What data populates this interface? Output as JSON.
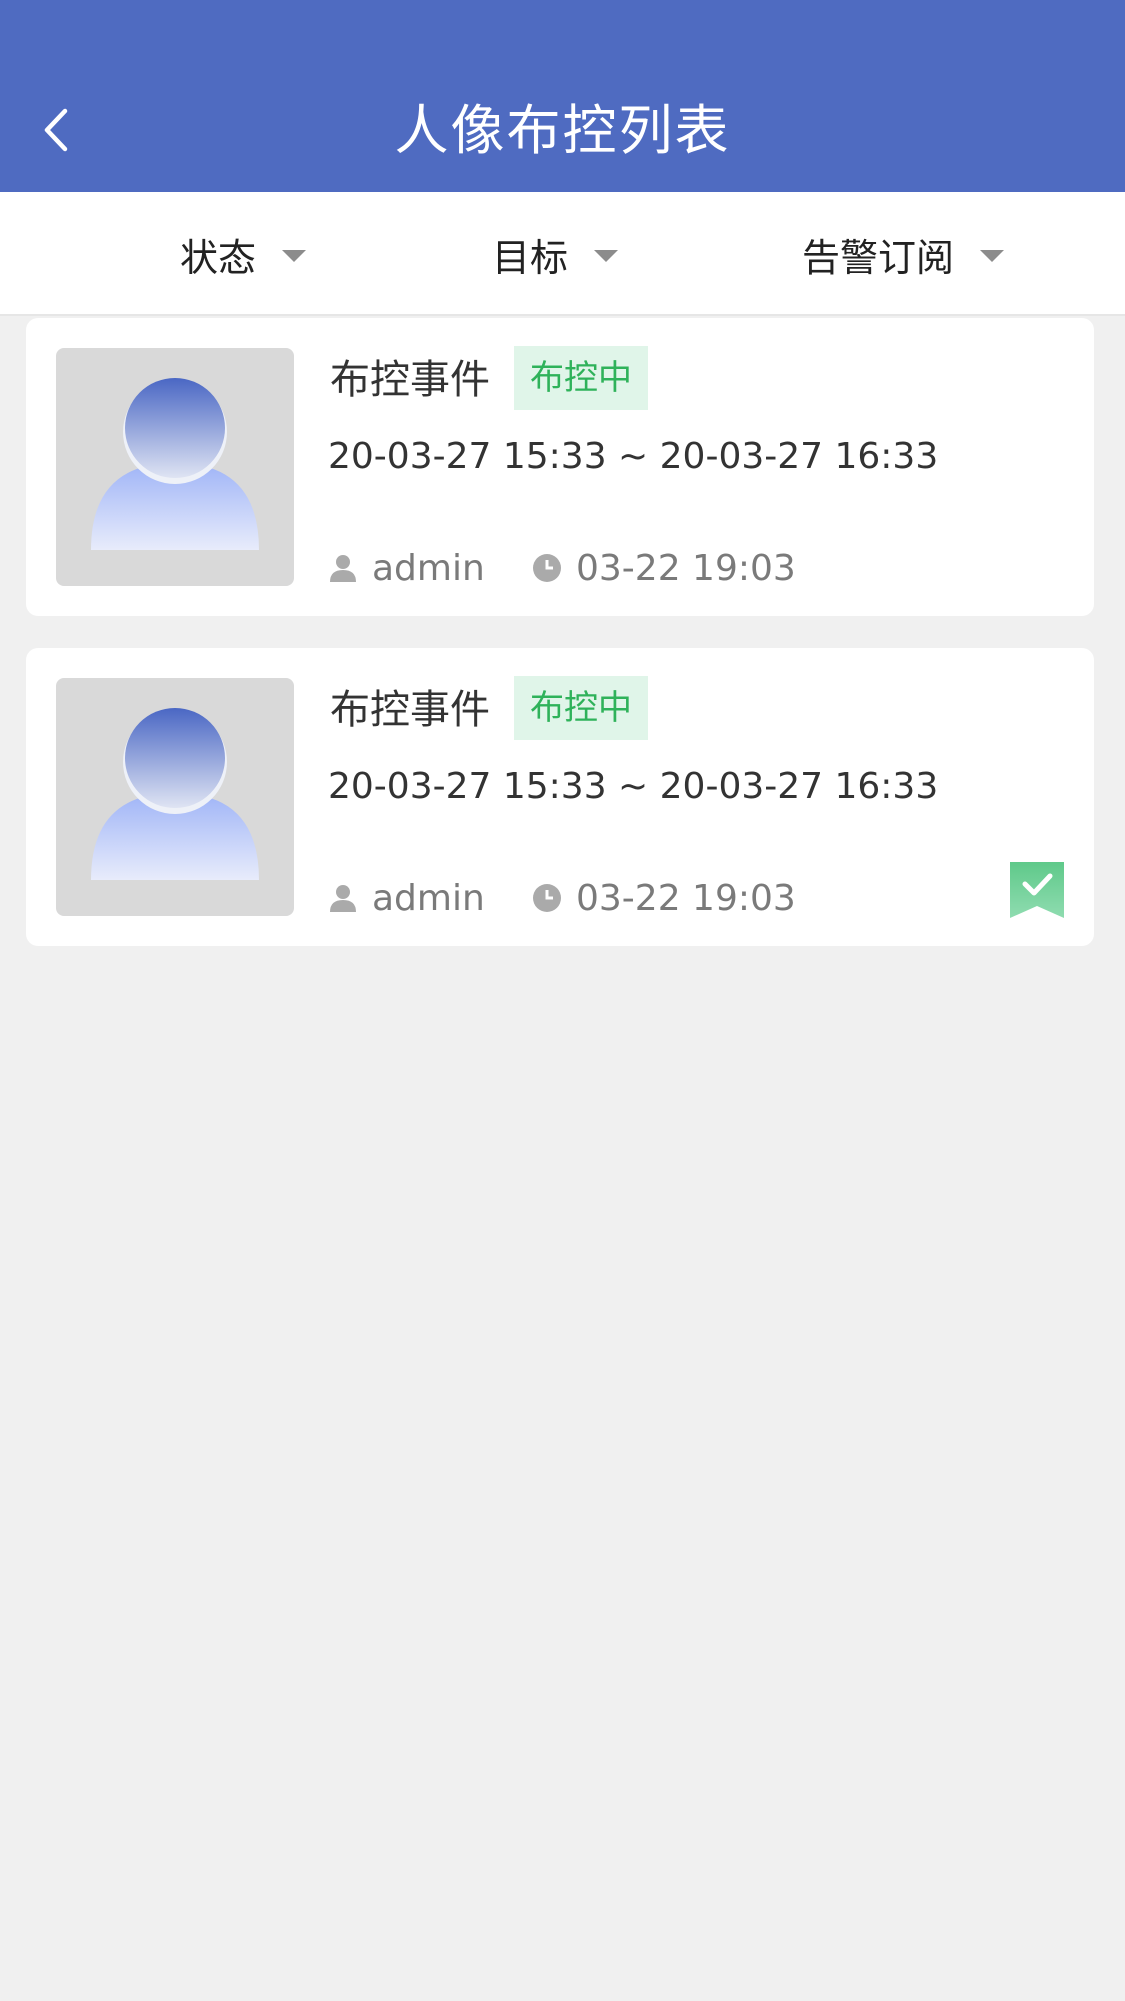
{
  "header": {
    "title": "人像布控列表",
    "background_color": "#4f6bc1"
  },
  "filters": [
    {
      "label": "状态"
    },
    {
      "label": "目标"
    },
    {
      "label": "告警订阅"
    }
  ],
  "events": [
    {
      "name": "布控事件",
      "status": "布控中",
      "time_range": "20-03-27 15:33 ~ 20-03-27 16:33",
      "user": "admin",
      "created": "03-22 19:03",
      "subscribed": false
    },
    {
      "name": "布控事件",
      "status": "布控中",
      "time_range": "20-03-27 15:33 ~ 20-03-27 16:33",
      "user": "admin",
      "created": "03-22 19:03",
      "subscribed": true
    }
  ],
  "colors": {
    "status_text": "#2fb25a",
    "status_bg": "#e0f5e9",
    "bookmark": "#5fc98a"
  }
}
